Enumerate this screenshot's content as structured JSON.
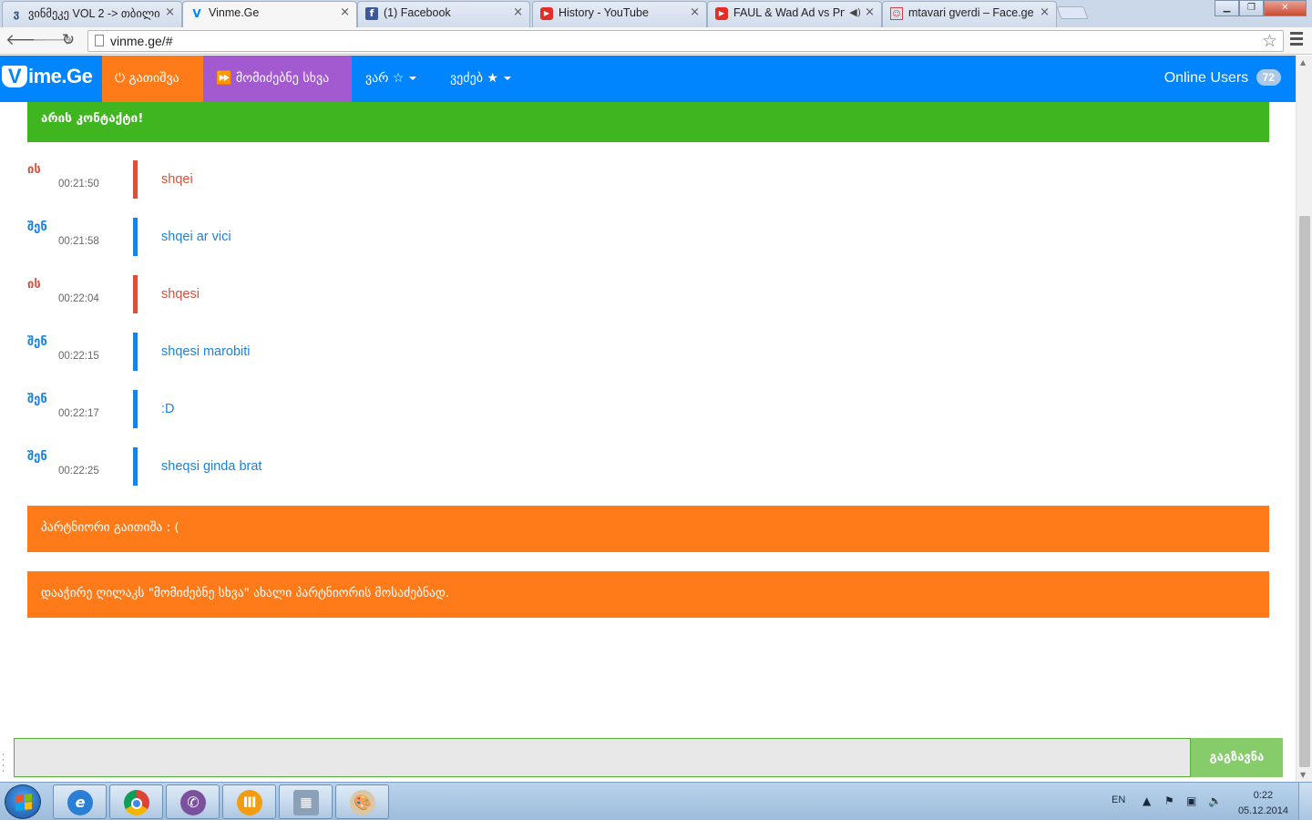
{
  "browser": {
    "tabs": [
      {
        "title": "ვინმეკე VOL 2 -> თბილი",
        "active": false,
        "favicon": "georgian-letter-icon"
      },
      {
        "title": "Vinme.Ge",
        "active": true,
        "favicon": "vinme-icon"
      },
      {
        "title": "(1) Facebook",
        "active": false,
        "favicon": "facebook-icon"
      },
      {
        "title": "History - YouTube",
        "active": false,
        "favicon": "youtube-icon"
      },
      {
        "title": "FAUL & Wad Ad vs Pnau",
        "active": false,
        "favicon": "youtube-icon",
        "audio": true
      },
      {
        "title": "mtavari gverdi – Face.ge",
        "active": false,
        "favicon": "face-ge-icon"
      }
    ],
    "url": "vinme.ge/#"
  },
  "navbar": {
    "logo_text": "ime.Ge",
    "logo_letter": "V",
    "disconnect_label": "გათიშვა",
    "next_label": "მომიძებნე სხვა",
    "male_label": "ვარ",
    "female_label": "ვეძებ",
    "online_label": "Online Users",
    "online_count": "72"
  },
  "chat": {
    "connected_banner": "არის კონტაქტი!",
    "messages": [
      {
        "who": "ის",
        "time": "00:21:50",
        "text": "shqei",
        "side": "them"
      },
      {
        "who": "შენ",
        "time": "00:21:58",
        "text": "shqei ar vici",
        "side": "me"
      },
      {
        "who": "ის",
        "time": "00:22:04",
        "text": "shqesi",
        "side": "them"
      },
      {
        "who": "შენ",
        "time": "00:22:15",
        "text": "shqesi marobiti",
        "side": "me"
      },
      {
        "who": "შენ",
        "time": "00:22:17",
        "text": ":D",
        "side": "me"
      },
      {
        "who": "შენ",
        "time": "00:22:25",
        "text": "sheqsi ginda brat",
        "side": "me"
      }
    ],
    "disconnected_banner": "პარტნიორი გაითიშა : (",
    "hint_banner": "დააჭირე ღილაკს \"მომიძებნე სხვა\" ახალი პარტნიორის მოსაძებნად."
  },
  "composer": {
    "value": "",
    "send_label": "გაგზავნა"
  },
  "taskbar": {
    "language": "EN",
    "time": "0:22",
    "date": "05.12.2014"
  },
  "colors": {
    "brand_blue": "#0085ff",
    "orange": "#ff7a18",
    "purple": "#a35ad0",
    "green": "#3fb51f",
    "partner": "#d9503f",
    "me": "#1a82e2"
  }
}
